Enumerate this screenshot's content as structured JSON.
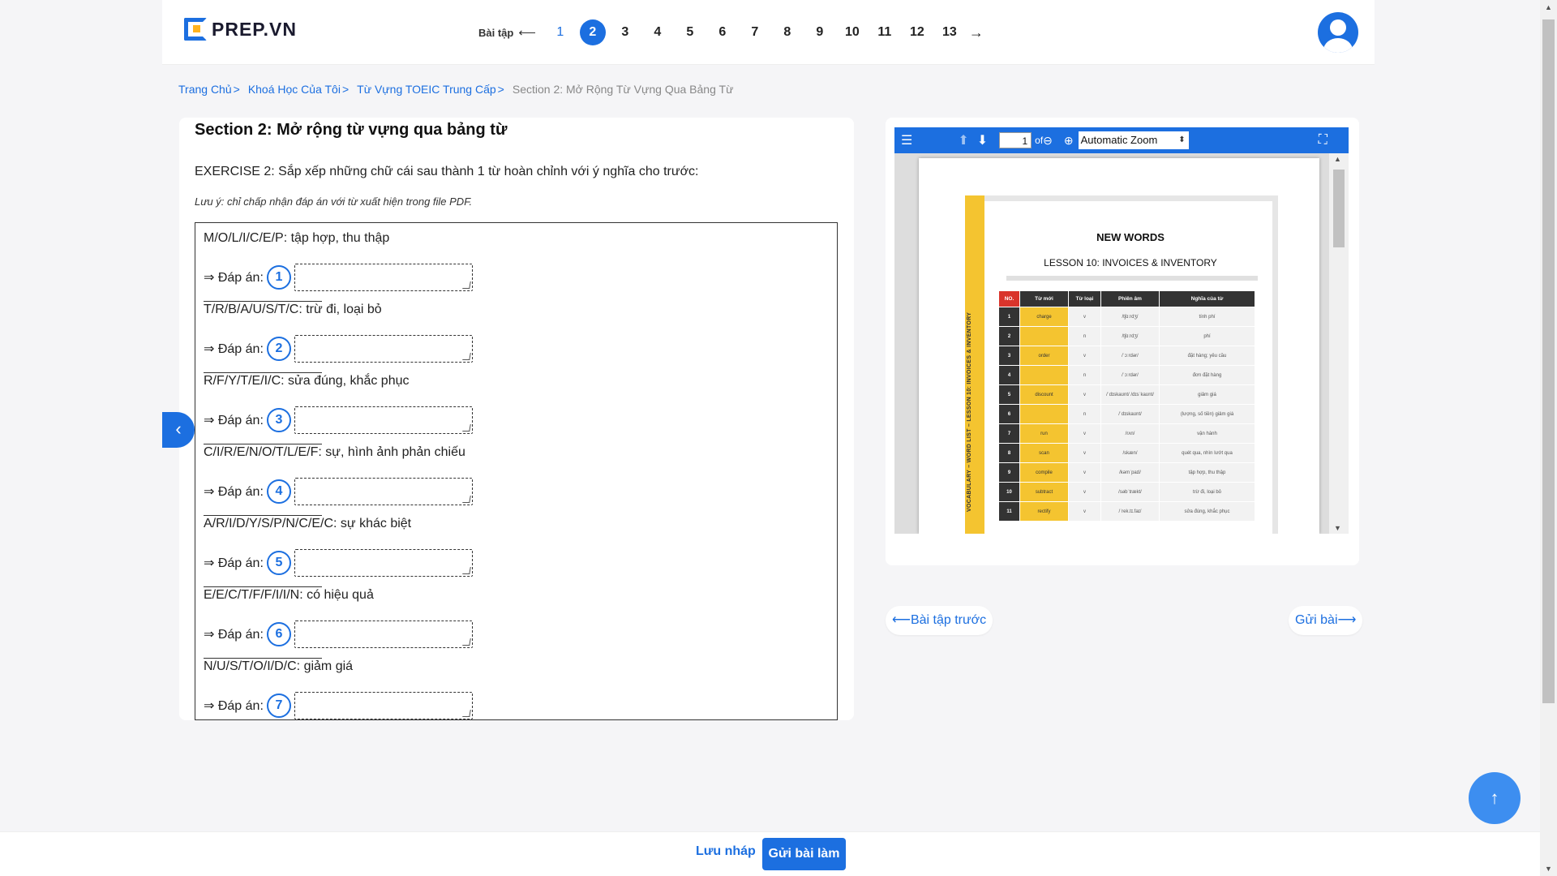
{
  "header": {
    "logo_text": "PREP.VN",
    "pager_label": "Bài tập",
    "pager_prev_arrow": "⟵",
    "pages": [
      "1",
      "2",
      "3",
      "4",
      "5",
      "6",
      "7",
      "8",
      "9",
      "10",
      "11",
      "12",
      "13"
    ],
    "current_page": "2",
    "pager_next_arrow": "→"
  },
  "breadcrumb": {
    "items": [
      "Trang Chủ",
      "Khoá Học Của Tôi",
      "Từ Vựng TOEIC Trung Cấp"
    ],
    "separator": ">",
    "current": "Section 2: Mở Rộng Từ Vựng Qua Bảng Từ"
  },
  "exercise": {
    "section_title": "Section 2: Mở rộng từ vựng qua bảng từ",
    "instruction": "EXERCISE 2: Sắp xếp những chữ cái sau thành 1 từ hoàn chỉnh với ý nghĩa cho trước:",
    "note": "Lưu ý: chỉ chấp nhận đáp án với từ xuất hiện trong file PDF.",
    "answer_label": "⇒ Đáp án:",
    "questions": [
      {
        "prompt": "M/O/L/I/C/E/P: tập hợp, thu thập",
        "num": "1",
        "value": ""
      },
      {
        "prompt": "T/R/B/A/U/S/T/C: trừ đi, loại bỏ",
        "num": "2",
        "value": ""
      },
      {
        "prompt": "R/F/Y/T/E/I/C: sửa đúng, khắc phục",
        "num": "3",
        "value": ""
      },
      {
        "prompt": "C/I/R/E/N/O/T/L/E/F: sự, hình ảnh phản chiếu",
        "num": "4",
        "value": ""
      },
      {
        "prompt": "A/R/I/D/Y/S/P/N/C/E/C: sự khác biệt",
        "num": "5",
        "value": ""
      },
      {
        "prompt": "E/E/C/T/F/F/I/I/N: có hiệu quả",
        "num": "6",
        "value": ""
      },
      {
        "prompt": "N/U/S/T/O/I/D/C: giảm giá",
        "num": "7",
        "value": ""
      }
    ]
  },
  "pdf_viewer": {
    "page_number": "1",
    "of_label": "of",
    "zoom": "Automatic Zoom",
    "doc": {
      "title": "NEW WORDS",
      "subtitle": "LESSON 10: INVOICES & INVENTORY",
      "side_label": "VOCABULARY – WORD LIST – LESSON 10: INVOICES & INVENTORY",
      "columns": [
        "NO.",
        "Từ mới",
        "Từ loại",
        "Phiên âm",
        "Nghĩa của từ"
      ],
      "rows": [
        {
          "no": "1",
          "word": "charge",
          "pos": "v",
          "ipa": "/tʃɑːrdʒ/",
          "meaning": "tính phí"
        },
        {
          "no": "2",
          "word": "",
          "pos": "n",
          "ipa": "/tʃɑːrdʒ/",
          "meaning": "phí"
        },
        {
          "no": "3",
          "word": "order",
          "pos": "v",
          "ipa": "/ˈɔːrdər/",
          "meaning": "đặt hàng; yêu cầu"
        },
        {
          "no": "4",
          "word": "",
          "pos": "n",
          "ipa": "/ˈɔːrdər/",
          "meaning": "đơn đặt hàng"
        },
        {
          "no": "5",
          "word": "discount",
          "pos": "v",
          "ipa": "/ˈdɪskaʊnt/ /dɪsˈkaʊnt/",
          "meaning": "giảm giá"
        },
        {
          "no": "6",
          "word": "",
          "pos": "n",
          "ipa": "/ˈdɪskaʊnt/",
          "meaning": "(lượng, số tiền) giảm giá"
        },
        {
          "no": "7",
          "word": "run",
          "pos": "v",
          "ipa": "/rʌn/",
          "meaning": "vận hành"
        },
        {
          "no": "8",
          "word": "scan",
          "pos": "v",
          "ipa": "/skæn/",
          "meaning": "quét qua, nhìn lướt qua"
        },
        {
          "no": "9",
          "word": "compile",
          "pos": "v",
          "ipa": "/kəmˈpaɪl/",
          "meaning": "tập hợp, thu thập"
        },
        {
          "no": "10",
          "word": "subtract",
          "pos": "v",
          "ipa": "/səbˈtrækt/",
          "meaning": "trừ đi, loại bỏ"
        },
        {
          "no": "11",
          "word": "rectify",
          "pos": "v",
          "ipa": "/ˈrek.tɪ.faɪ/",
          "meaning": "sửa đúng, khắc phục"
        }
      ]
    }
  },
  "navigation": {
    "prev_label": "⟵Bài tập trước",
    "next_label": "Gửi bài⟶"
  },
  "footer": {
    "draft_label": "Lưu nháp",
    "submit_label": "Gửi bài làm"
  },
  "colors": {
    "primary": "#1c6fe0",
    "accent_yellow": "#f4c430",
    "header_red": "#d9342b"
  }
}
